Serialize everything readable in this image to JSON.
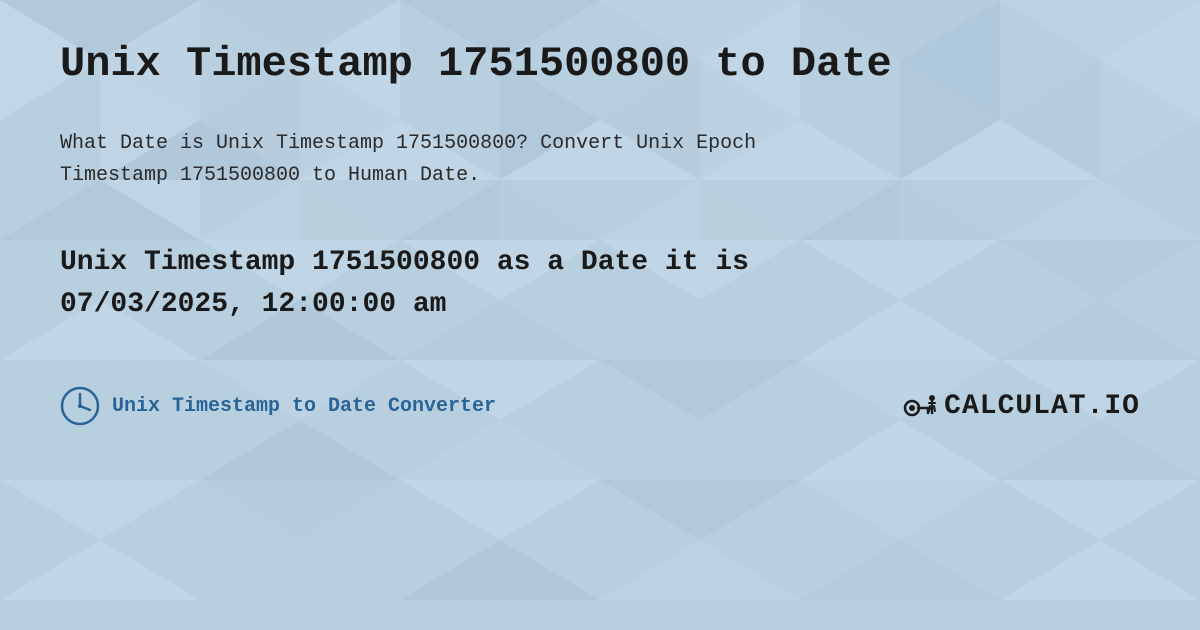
{
  "page": {
    "title": "Unix Timestamp 1751500800 to Date",
    "description_line1": "What Date is Unix Timestamp 1751500800? Convert Unix Epoch",
    "description_line2": "Timestamp 1751500800 to Human Date.",
    "result_line1": "Unix Timestamp 1751500800 as a Date it is",
    "result_line2": "07/03/2025, 12:00:00 am",
    "footer_label": "Unix Timestamp to Date Converter",
    "logo_text": "CALCULAT.IO",
    "bg_color": "#c8d8e8",
    "title_color": "#1a1a1a",
    "text_color": "#2a2a2a",
    "result_color": "#1a1a1a",
    "link_color": "#2a6496"
  }
}
